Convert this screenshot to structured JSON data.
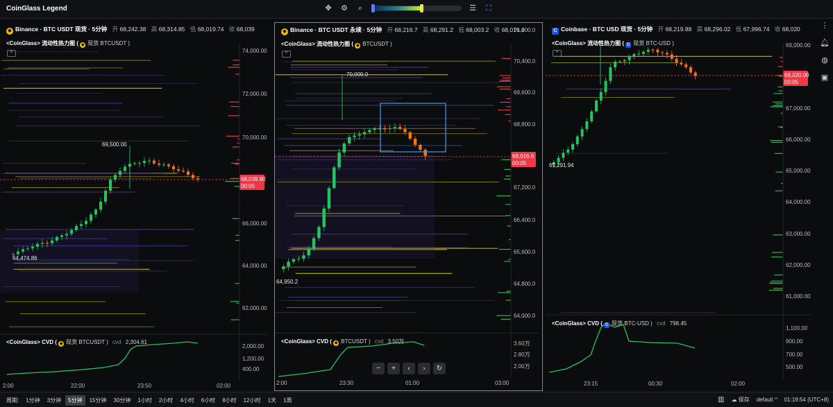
{
  "app": {
    "title": "CoinGlass Legend"
  },
  "colors": {
    "up": "#22c55e",
    "down": "#f97316",
    "last_price": "#f23645",
    "cvd": "#22c55e",
    "selection": "#3aa0ff"
  },
  "panels": [
    {
      "exchange": "Binance",
      "symbol_title": "Binance · BTC USDT 现货 · 5分钟",
      "ohlc": {
        "open_label": "开",
        "open": "68,242.38",
        "high_label": "高",
        "high": "68,314.85",
        "low_label": "低",
        "low": "68,019.74",
        "close_label": "收",
        "close": "68,039"
      },
      "heatmap_title": "<CoinGlass> 流动性热力图 (",
      "heatmap_ticker": "现货 BTCUSDT )",
      "price_axis": [
        "74,000.00",
        "72,000.00",
        "70,000.00",
        "66,000.00",
        "64,000.00",
        "62,000.00"
      ],
      "last_price": "68,039.80",
      "countdown": "00:05",
      "high_annotation": "69,500.00",
      "low_annotation": "64,474.86",
      "cvd_title": "<CoinGlass> CVD (",
      "cvd_ticker": "现货 BTCUSDT )",
      "cvd_key": "cvd",
      "cvd_value": "2,304.61",
      "cvd_axis": [
        "2,000.00",
        "1,200.00",
        "400.00"
      ],
      "time_axis": [
        "2:00",
        "22:00",
        "23:50",
        "02:00"
      ]
    },
    {
      "exchange": "Binance",
      "symbol_title": "Binance · BTC USDT 永续 · 5分钟",
      "ohlc": {
        "open_label": "开",
        "open": "68,216.7",
        "high_label": "高",
        "high": "68,291.2",
        "low_label": "低",
        "low": "68,003.2",
        "close_label": "收",
        "close": "68,016.6"
      },
      "heatmap_title": "<CoinGlass> 流动性热力图 (",
      "heatmap_ticker": "BTCUSDT )",
      "price_axis": [
        "71,200.0",
        "70,400.0",
        "69,600.0",
        "68,800.0",
        "67,200.0",
        "66,400.0",
        "65,600.0",
        "64,800.0",
        "64,000.0"
      ],
      "last_price": "68,016.6",
      "countdown": "00:05",
      "high_annotation": "70,000.0",
      "low_annotation": "64,950.2",
      "cvd_title": "<CoinGlass> CVD (",
      "cvd_ticker": "BTCUSDT )",
      "cvd_key": "cvd",
      "cvd_value": "3.50万",
      "cvd_axis": [
        "3.60万",
        "2.80万",
        "2.00万"
      ],
      "time_axis": [
        "2:00",
        "23:30",
        "01:00",
        "03:00"
      ],
      "nav_buttons": [
        "−",
        "+",
        "‹",
        "›",
        "↻"
      ]
    },
    {
      "exchange": "Coinbase",
      "symbol_title": "Coinbase · BTC USD 现货 · 5分钟",
      "ohlc": {
        "open_label": "开",
        "open": "68,219.88",
        "high_label": "高",
        "high": "68,296.02",
        "low_label": "低",
        "low": "67,996.74",
        "close_label": "收",
        "close": "68,020"
      },
      "heatmap_title": "<CoinGlass> 流动性热力图 (",
      "heatmap_ticker": "现货 BTC-USD )",
      "price_axis": [
        "69,000.00",
        "67,000.00",
        "66,000.00",
        "65,000.00",
        "64,000.00",
        "63,000.00",
        "62,000.00",
        "61,000.00"
      ],
      "last_price": "68,020.00",
      "countdown": "00:05",
      "low_annotation": "65,291.94",
      "cvd_title": "<CoinGlass> CVD (",
      "cvd_ticker": "现货 BTC-USD )",
      "cvd_key": "cvd",
      "cvd_value": "798.45",
      "cvd_axis": [
        "1,100.00",
        "900.00",
        "700.00",
        "500.00"
      ],
      "time_axis": [
        "23:15",
        "00:30",
        "02:00"
      ]
    }
  ],
  "statusbar": {
    "period_label": "周期:",
    "periods": [
      "1分钟",
      "3分钟",
      "5分钟",
      "15分钟",
      "30分钟",
      "1小时",
      "2小时",
      "4小时",
      "6小时",
      "8小时",
      "12小时",
      "1天",
      "1周"
    ],
    "active_period": "5分钟",
    "save_label": "保存",
    "layout_name": "default",
    "clock": "01:19:54 (UTC+8)"
  }
}
